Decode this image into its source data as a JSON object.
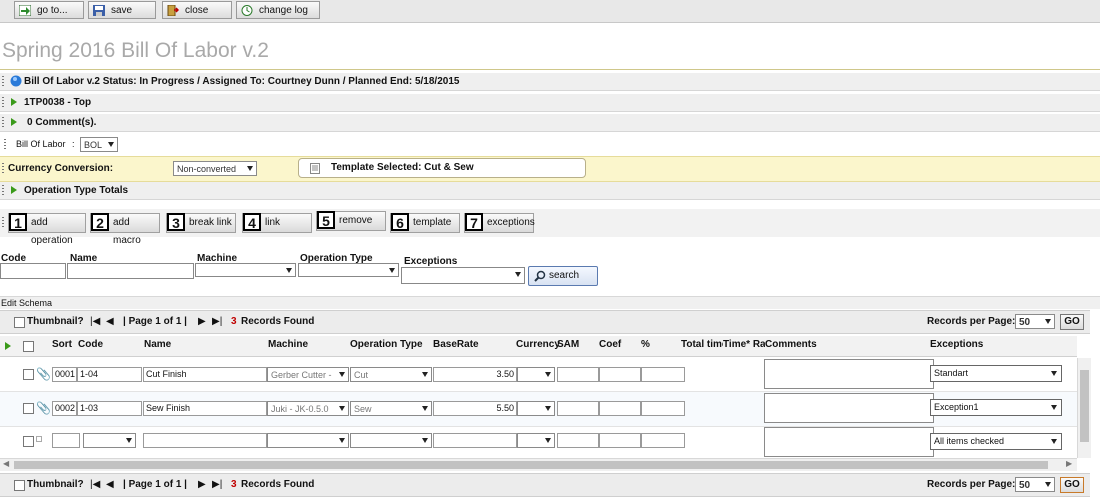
{
  "toolbar": {
    "goto_label": "go to...",
    "save_label": "save",
    "close_label": "close",
    "changelog_label": "change log"
  },
  "page_title": "Spring 2016 Bill Of Labor v.2",
  "status_bar": "Bill Of Labor v.2  Status: In Progress / Assigned To: Courtney Dunn / Planned End: 5/18/2015",
  "style_bar": "1TP0038 - Top",
  "comments_bar": "0 Comment(s).",
  "bol_selector": {
    "label": "Bill Of Labor",
    "sep": ":",
    "value": "BOL"
  },
  "currency": {
    "label": "Currency Conversion:",
    "value": "Non-converted",
    "template": "Template Selected: Cut & Sew"
  },
  "op_totals": "Operation Type Totals",
  "actions": [
    {
      "num": "1",
      "label": "add operation"
    },
    {
      "num": "2",
      "label": "add macro"
    },
    {
      "num": "3",
      "label": "break link"
    },
    {
      "num": "4",
      "label": "link"
    },
    {
      "num": "5",
      "label": "remove"
    },
    {
      "num": "6",
      "label": "template"
    },
    {
      "num": "7",
      "label": "exceptions"
    }
  ],
  "filters": {
    "code": "Code",
    "name": "Name",
    "machine": "Machine",
    "operation_type": "Operation Type",
    "exceptions": "Exceptions",
    "search": "search"
  },
  "edit_schema": "Edit Schema",
  "pager": {
    "thumbnail": "Thumbnail?",
    "page": "| Page 1 of 1 |",
    "records_count": "3",
    "records_text": "Records Found",
    "per_page_label": "Records per Page:",
    "per_page": "50",
    "go": "GO"
  },
  "columns": {
    "sort": "Sort",
    "code": "Code",
    "name": "Name",
    "machine": "Machine",
    "operation_type": "Operation Type",
    "baserate": "BaseRate",
    "currency": "Currency",
    "sam": "SAM",
    "coef": "Coef",
    "percent": "%",
    "total_time": "Total time",
    "time_rate": "Time* Rate",
    "comments": "Comments",
    "exceptions": "Exceptions"
  },
  "rows": [
    {
      "sort": "0001",
      "code": "1-04",
      "name": "Cut Finish",
      "machine": "Gerber Cutter -",
      "op_type": "Cut",
      "baserate": "3.50",
      "exception": "Standart"
    },
    {
      "sort": "0002",
      "code": "1-03",
      "name": "Sew Finish",
      "machine": "Juki - JK-0.5.0",
      "op_type": "Sew",
      "baserate": "5.50",
      "exception": "Exception1"
    }
  ],
  "new_row": {
    "exception": "All items checked"
  },
  "colors": {
    "accent_green": "#3a9a1a",
    "records_red": "#c00000",
    "yellow_bar": "#fbf6cc"
  }
}
